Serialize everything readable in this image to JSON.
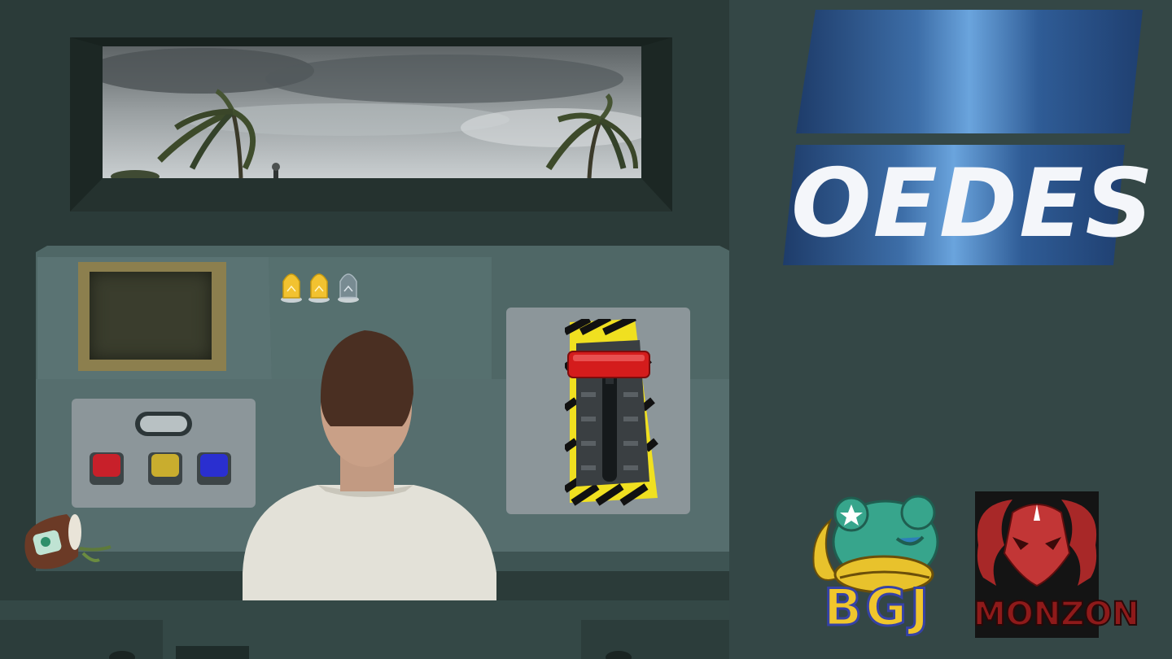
{
  "game": {
    "title": "OEDES"
  },
  "sponsors": {
    "bgj_label": "BGJ",
    "monzon_label": "MONZON"
  },
  "status": {
    "lives_total": 3,
    "lives_remaining": 2
  },
  "colors": {
    "button_red": "#c8202a",
    "button_yellow": "#c9ad2e",
    "button_blue": "#2a2fd0",
    "lever_handle": "#d41c1c",
    "bulb_on": "#f2c230",
    "bulb_off": "#8a9aa6"
  },
  "icons": {
    "bulb": "light-bulb-icon",
    "lever": "emergency-lever-icon"
  }
}
